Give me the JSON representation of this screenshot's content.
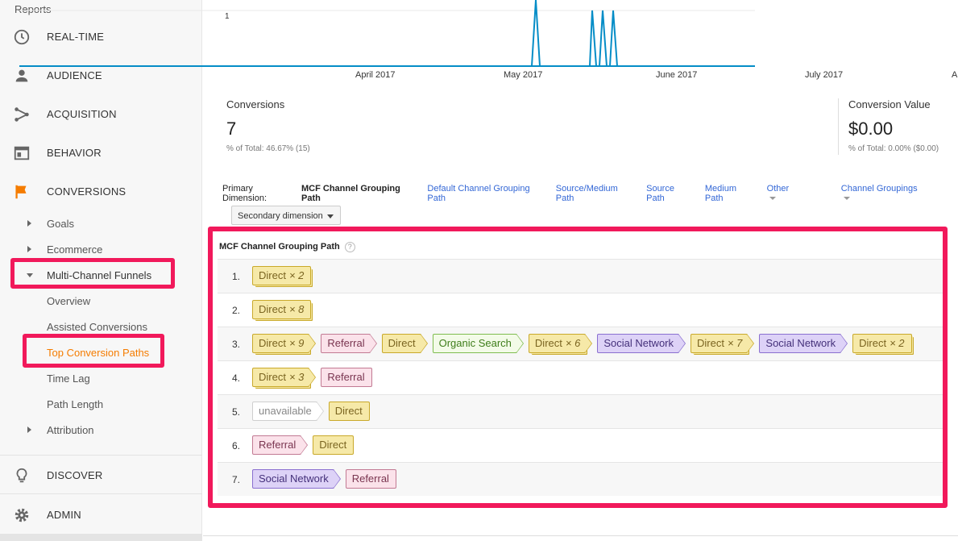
{
  "sidebar": {
    "section_label": "Reports",
    "main_items": [
      {
        "label": "REAL-TIME",
        "icon": "clock-icon"
      },
      {
        "label": "AUDIENCE",
        "icon": "person-icon"
      },
      {
        "label": "ACQUISITION",
        "icon": "acquisition-icon"
      },
      {
        "label": "BEHAVIOR",
        "icon": "behavior-icon"
      },
      {
        "label": "CONVERSIONS",
        "icon": "flag-icon"
      }
    ],
    "conversions_sub": {
      "goals": "Goals",
      "ecommerce": "Ecommerce",
      "mcf": "Multi-Channel Funnels",
      "mcf_items": [
        "Overview",
        "Assisted Conversions",
        "Top Conversion Paths",
        "Time Lag",
        "Path Length"
      ],
      "attribution": "Attribution"
    },
    "discover": "DISCOVER",
    "admin": "ADMIN",
    "accent_color": "#f57c00",
    "highlight_color": "#f1195b"
  },
  "chart": {
    "y_tick": "1",
    "x_labels": [
      "April 2017",
      "May 2017",
      "June 2017",
      "July 2017",
      "A"
    ],
    "line_color": "#058dc7"
  },
  "kpis": [
    {
      "title": "Conversions",
      "value": "7",
      "sub": "% of Total: 46.67% (15)"
    },
    {
      "title": "Conversion Value",
      "value": "$0.00",
      "sub": "% of Total: 0.00% ($0.00)"
    }
  ],
  "dimensions": {
    "label": "Primary Dimension:",
    "active": "MCF Channel Grouping Path",
    "links": [
      "Default Channel Grouping Path",
      "Source/Medium Path",
      "Source Path",
      "Medium Path"
    ],
    "other": "Other",
    "channel_groupings": "Channel Groupings"
  },
  "secondary_dimension": "Secondary dimension",
  "table": {
    "header": "MCF Channel Grouping Path",
    "help": "?",
    "rows": [
      {
        "num": "1.",
        "path": [
          {
            "name": "Direct",
            "mult": "× 2",
            "type": "direct"
          }
        ]
      },
      {
        "num": "2.",
        "path": [
          {
            "name": "Direct",
            "mult": "× 8",
            "type": "direct"
          }
        ]
      },
      {
        "num": "3.",
        "path": [
          {
            "name": "Direct",
            "mult": "× 9",
            "type": "direct"
          },
          {
            "name": "Referral",
            "type": "ref"
          },
          {
            "name": "Direct",
            "type": "direct"
          },
          {
            "name": "Organic Search",
            "type": "org"
          },
          {
            "name": "Direct",
            "mult": "× 6",
            "type": "direct"
          },
          {
            "name": "Social Network",
            "type": "soc"
          },
          {
            "name": "Direct",
            "mult": "× 7",
            "type": "direct"
          },
          {
            "name": "Social Network",
            "type": "soc"
          },
          {
            "name": "Direct",
            "mult": "× 2",
            "type": "direct"
          }
        ]
      },
      {
        "num": "4.",
        "path": [
          {
            "name": "Direct",
            "mult": "× 3",
            "type": "direct"
          },
          {
            "name": "Referral",
            "type": "ref"
          }
        ]
      },
      {
        "num": "5.",
        "path": [
          {
            "name": "unavailable",
            "type": "una"
          },
          {
            "name": "Direct",
            "type": "direct"
          }
        ]
      },
      {
        "num": "6.",
        "path": [
          {
            "name": "Referral",
            "type": "ref"
          },
          {
            "name": "Direct",
            "type": "direct"
          }
        ]
      },
      {
        "num": "7.",
        "path": [
          {
            "name": "Social Network",
            "type": "soc"
          },
          {
            "name": "Referral",
            "type": "ref"
          }
        ]
      }
    ]
  }
}
